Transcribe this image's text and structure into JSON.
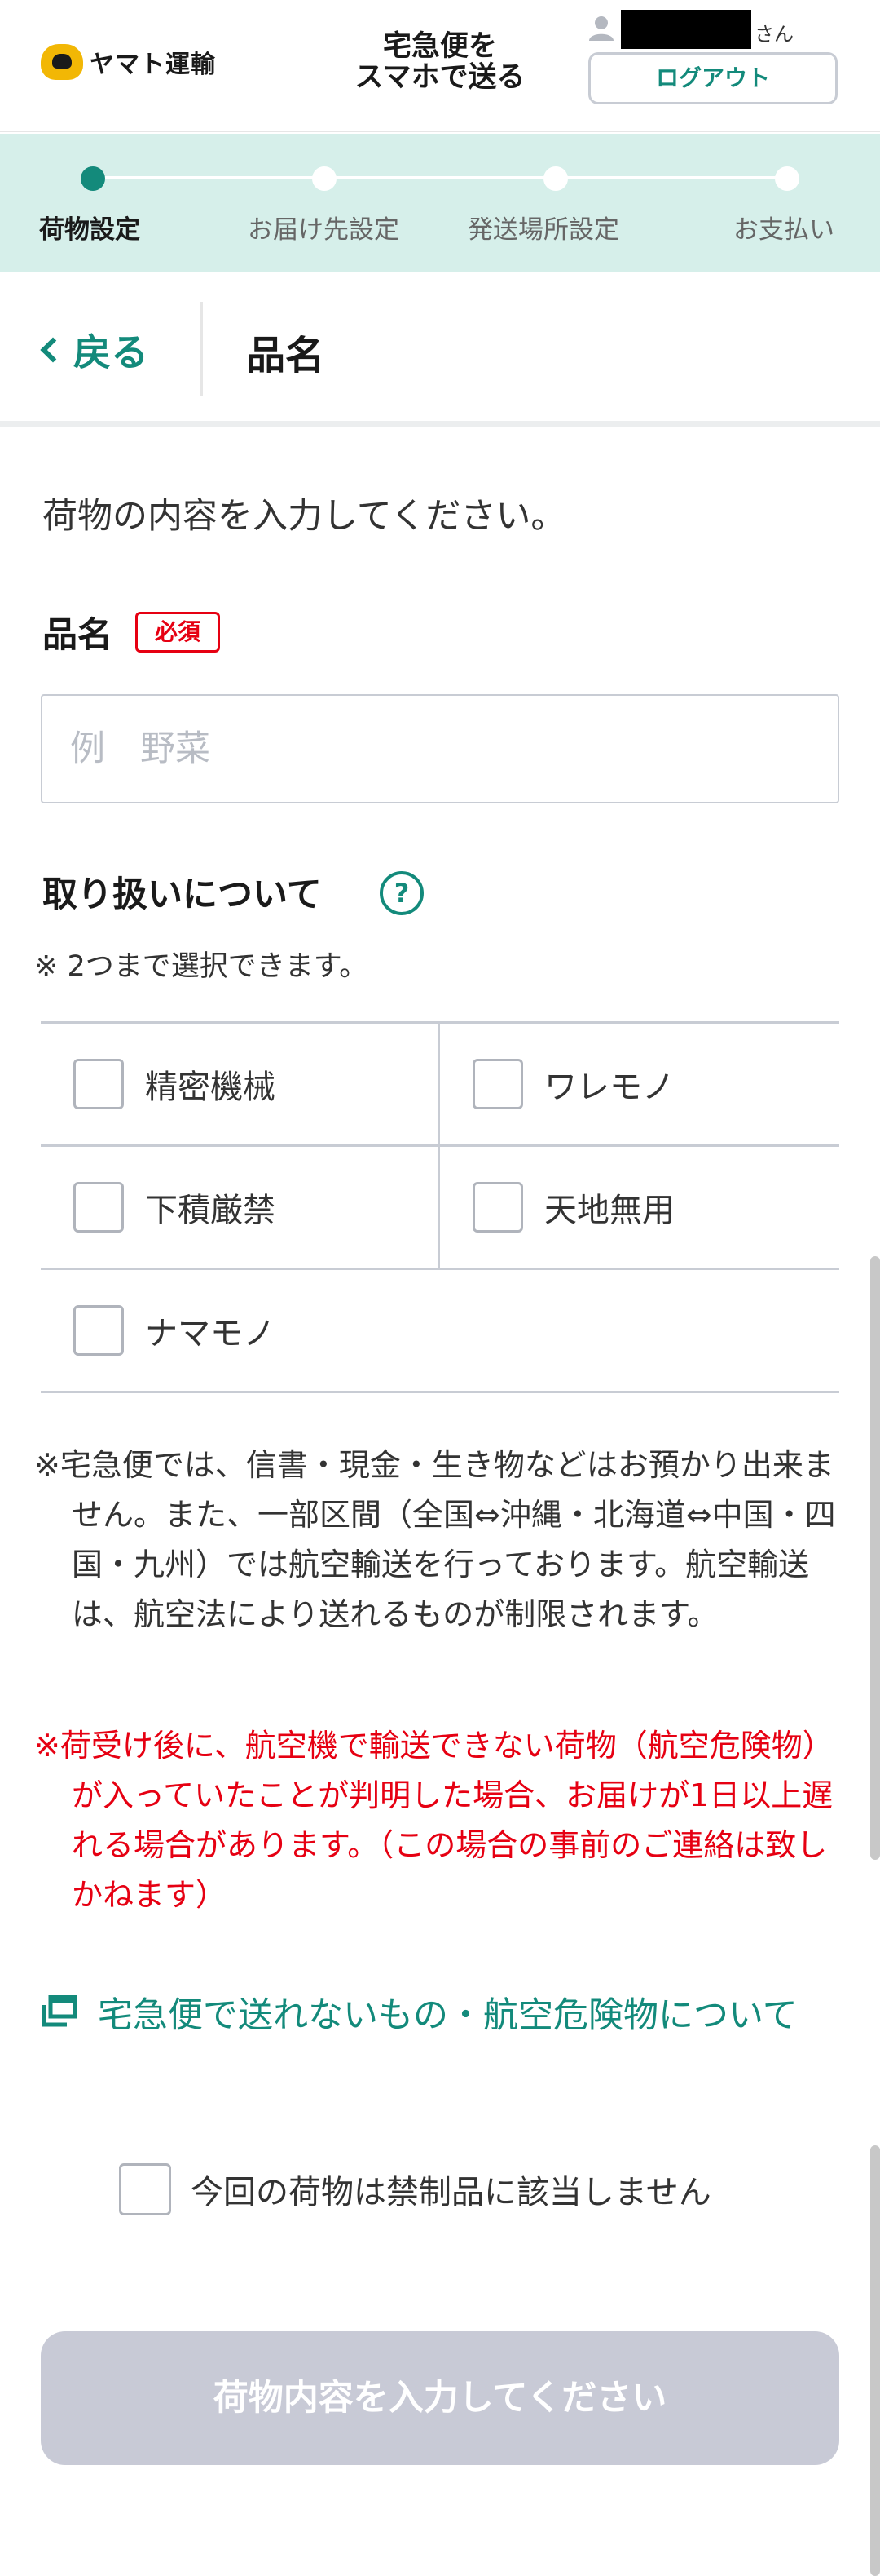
{
  "header": {
    "logo_text": "ヤマト運輸",
    "service_name": "宅急便を\nスマホで送る",
    "user_suffix": "さん",
    "logout_label": "ログアウト"
  },
  "stepper": {
    "steps": [
      {
        "label": "荷物設定",
        "active": true
      },
      {
        "label": "お届け先設定",
        "active": false
      },
      {
        "label": "発送場所設定",
        "active": false
      },
      {
        "label": "お支払い",
        "active": false
      }
    ]
  },
  "titlebar": {
    "back_label": "戻る",
    "title": "品名"
  },
  "form": {
    "intro": "荷物の内容を入力してください。",
    "item_name_label": "品名",
    "required_badge": "必須",
    "item_name_placeholder": "例　野菜",
    "item_name_value": "",
    "handling_label": "取り扱いについて",
    "help_icon_glyph": "?",
    "handling_note": "※ 2つまで選択できます。",
    "handling_options": [
      {
        "label": "精密機械",
        "checked": false
      },
      {
        "label": "ワレモノ",
        "checked": false
      },
      {
        "label": "下積厳禁",
        "checked": false
      },
      {
        "label": "天地無用",
        "checked": false
      },
      {
        "label": "ナマモノ",
        "checked": false
      }
    ],
    "notice": "※宅急便では、信書・現金・生き物などはお預かり出来ません。また、一部区間（全国⇔沖縄・北海道⇔中国・四国・九州）では航空輸送を行っております。航空輸送は、航空法により送れるものが制限されます。",
    "warning": "※荷受け後に、航空機で輸送できない荷物（航空危険物）が入っていたことが判明した場合、お届けが1日以上遅れる場合があります。（この場合の事前のご連絡は致しかねます）",
    "link_text": "宅急便で送れないもの・航空危険物について",
    "confirm_label": "今回の荷物は禁制品に該当しません",
    "confirm_checked": false,
    "submit_label": "荷物内容を入力してください"
  },
  "colors": {
    "accent": "#138a7b",
    "stepper_bg": "#d6efea",
    "required_red": "#e60012",
    "disabled_button": "#c8cad6"
  }
}
